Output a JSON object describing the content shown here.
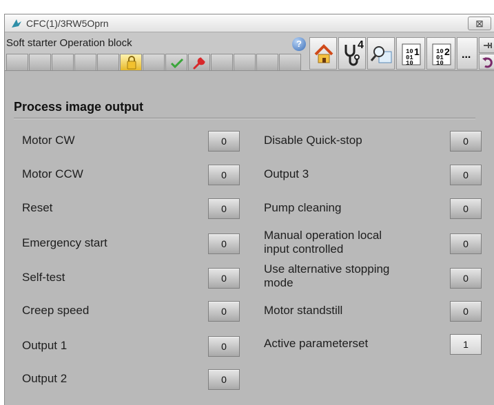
{
  "window": {
    "title": "CFC(1)/3RW5Oprn",
    "close_label": "⊠",
    "app_icon": "bird-icon"
  },
  "header": {
    "block_title": "Soft starter Operation block",
    "help_label": "?",
    "toolbar": {
      "stethoscope_count": "4",
      "counter1": {
        "number": "1",
        "bits": [
          "10",
          "01",
          "10"
        ]
      },
      "counter2": {
        "number": "2",
        "bits": [
          "10",
          "01",
          "10"
        ]
      },
      "more_label": "..."
    },
    "status_leds": [
      "off",
      "off",
      "off",
      "off",
      "off",
      "lock",
      "off",
      "ok",
      "wrench",
      "off",
      "off",
      "off",
      "off"
    ]
  },
  "section": {
    "title": "Process image output"
  },
  "left_outputs": [
    {
      "label": "Motor CW",
      "value": "0"
    },
    {
      "label": "Motor CCW",
      "value": "0"
    },
    {
      "label": "Reset",
      "value": "0"
    },
    {
      "label": "Emergency start",
      "value": "0"
    },
    {
      "label": "Self-test",
      "value": "0"
    },
    {
      "label": "Creep speed",
      "value": "0"
    },
    {
      "label": "Output 1",
      "value": "0"
    },
    {
      "label": "Output 2",
      "value": "0"
    }
  ],
  "right_outputs": [
    {
      "label": "Disable Quick-stop",
      "value": "0"
    },
    {
      "label": "Output 3",
      "value": "0"
    },
    {
      "label": "Pump cleaning",
      "value": "0"
    },
    {
      "label_line1": "Manual operation local",
      "label_line2": "input controlled",
      "value": "0"
    },
    {
      "label_line1": "Use alternative stopping",
      "label_line2": "mode",
      "value": "0"
    },
    {
      "label": "Motor standstill",
      "value": "0"
    },
    {
      "label": "Active parameterset",
      "value": "1"
    }
  ],
  "colors": {
    "window_bg": "#b9b9b9",
    "header_bg": "#c8c8c8",
    "help_blue": "#3c6fb8",
    "lock_yellow": "#f2c12e",
    "check_green": "#3aa63a",
    "wrench_red": "#d8282b"
  }
}
